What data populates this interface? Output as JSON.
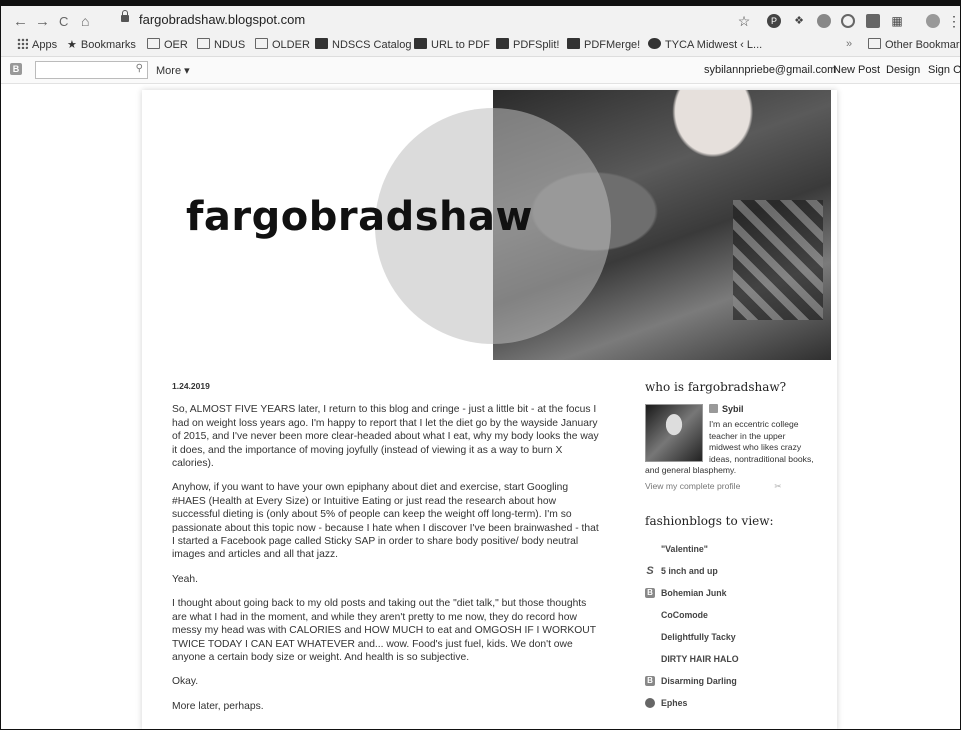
{
  "browser": {
    "url": "fargobradshaw.blogspot.com",
    "back": "←",
    "forward": "→",
    "reload": "C",
    "home": "⌂",
    "star": "☆",
    "menu": "⋮"
  },
  "bookmarks": [
    {
      "label": "Apps",
      "icon": "grid"
    },
    {
      "label": "Bookmarks",
      "icon": "star"
    },
    {
      "label": "OER",
      "icon": "folder"
    },
    {
      "label": "NDUS",
      "icon": "folder"
    },
    {
      "label": "OLDER",
      "icon": "folder"
    },
    {
      "label": "NDSCS Catalog",
      "icon": "app"
    },
    {
      "label": "URL to PDF",
      "icon": "app"
    },
    {
      "label": "PDFSplit!",
      "icon": "app"
    },
    {
      "label": "PDFMerge!",
      "icon": "app"
    },
    {
      "label": "TYCA Midwest ‹ L...",
      "icon": "app"
    }
  ],
  "bookmarks_overflow": "»",
  "other_bookmarks": "Other Bookmarks",
  "blogger_bar": {
    "logo": "B",
    "more": "More ▾",
    "email": "sybilannpriebe@gmail.com",
    "new_post": "New Post",
    "design": "Design",
    "sign_out": "Sign Ou"
  },
  "blog": {
    "title": "fargobradshaw"
  },
  "post": {
    "date": "1.24.2019",
    "paragraphs": [
      "So, ALMOST FIVE YEARS later, I return to this blog and cringe - just a little bit - at the focus I had on weight loss years ago. I'm happy to report that I let the diet go by the wayside January of 2015, and I've never been more clear-headed about what I eat, why my body looks the way it does, and the importance of moving joyfully (instead of viewing it as a way to burn X calories).",
      "Anyhow, if you want to have your own epiphany about diet and exercise, start Googling #HAES (Health at Every Size) or Intuitive Eating or just read the research about how successful dieting is (only about 5% of people can keep the weight off long-term). I'm so passionate about this topic now - because I hate when I discover I've been brainwashed - that I started a Facebook page called Sticky SAP in order to share body positive/ body neutral images and articles and all that jazz.",
      "Yeah.",
      "I thought about going back to my old posts and taking out the \"diet talk,\" but those thoughts are what I had in the moment, and while they aren't pretty to me now, they do record how messy my head was with CALORIES and HOW MUCH to eat and OMGOSH IF I WORKOUT TWICE TODAY I CAN EAT WHATEVER and... wow. Food's just fuel, kids. We don't owe anyone a certain body size or weight. And health is so subjective.",
      "Okay.",
      "More later, perhaps."
    ]
  },
  "sidebar": {
    "about_title": "who is fargobradshaw?",
    "profile_name": "Sybil",
    "about_text": "I'm an eccentric college teacher in the upper midwest who likes crazy ideas, nontraditional books, and general blasphemy.",
    "view_profile": "View my complete profile",
    "blogs_title": "fashionblogs to view:",
    "blogs": [
      {
        "label": "\"Valentine\"",
        "icon": "none"
      },
      {
        "label": "5 inch and up",
        "icon": "s"
      },
      {
        "label": "Bohemian Junk",
        "icon": "blogger"
      },
      {
        "label": "CoComode",
        "icon": "none"
      },
      {
        "label": "Delightfully Tacky",
        "icon": "none"
      },
      {
        "label": "DIRTY HAIR HALO",
        "icon": "none"
      },
      {
        "label": "Disarming Darling",
        "icon": "blogger"
      },
      {
        "label": "Ephes",
        "icon": "round"
      }
    ]
  }
}
